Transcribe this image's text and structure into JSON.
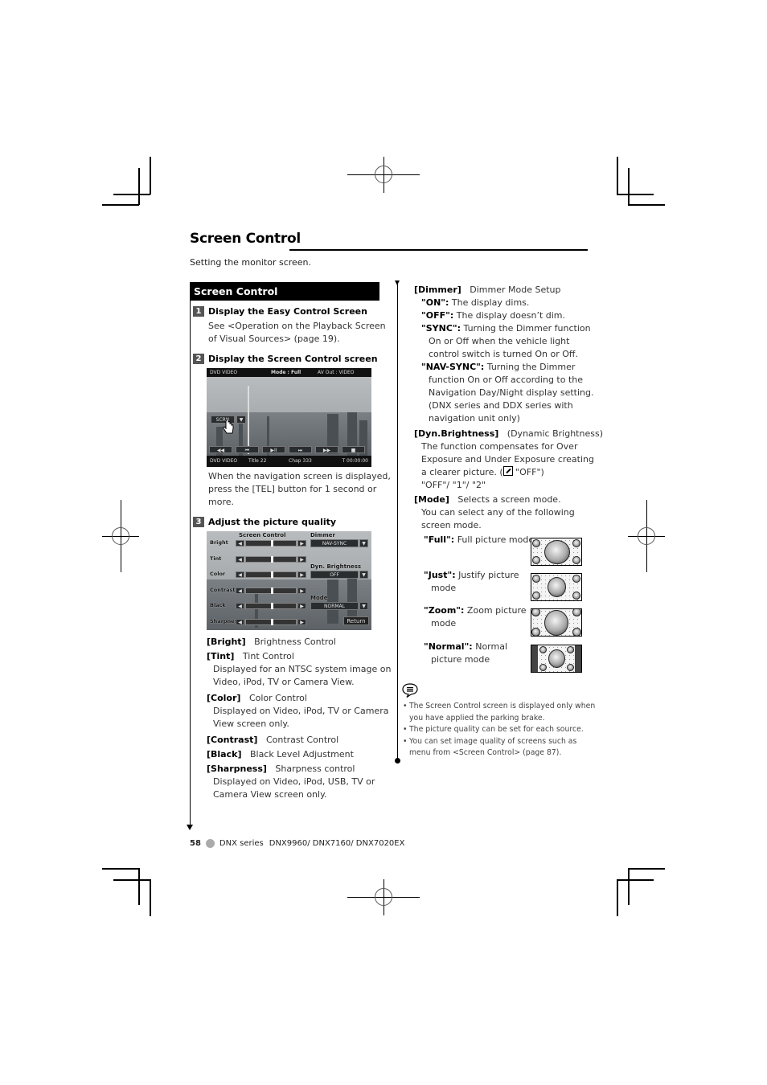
{
  "page": {
    "title": "Screen Control",
    "intro": "Setting the monitor screen.",
    "section_header": "Screen Control"
  },
  "steps": [
    {
      "num": "1",
      "title": "Display the Easy Control Screen",
      "text_lines": [
        "See <Operation on the Playback Screen",
        "of Visual Sources> (page 19)."
      ]
    },
    {
      "num": "2",
      "title": "Display the Screen Control screen",
      "text_lines": [
        "When the navigation screen is displayed,",
        "press the [TEL] button for 1 second or",
        "more."
      ]
    },
    {
      "num": "3",
      "title": "Adjust the picture quality"
    }
  ],
  "easy_control_screen": {
    "top_left": "DVD VIDEO",
    "top_mode": "Mode : Full",
    "top_av": "AV Out : VIDEO",
    "scrn_button": "SCRN",
    "scrn_arrow": "▼",
    "transport": [
      "◀◀",
      "⏮",
      "▶II",
      "⏭",
      "▶▶",
      "■"
    ],
    "bottom_left": "DVD VIDEO",
    "bottom_title": "Title 22",
    "bottom_chap": "Chap 333",
    "bottom_time": "T 00:00:00"
  },
  "screen_control_screen": {
    "heading": "Screen Control",
    "rows": [
      {
        "label": "Bright",
        "level": 0.5
      },
      {
        "label": "Tint",
        "level": 0.5
      },
      {
        "label": "Color",
        "level": 0.5
      },
      {
        "label": "Contrast",
        "level": 0.5
      },
      {
        "label": "Black",
        "level": 0.5
      },
      {
        "label": "Sharpness",
        "level": 0.5
      }
    ],
    "dimmer_label": "Dimmer",
    "dimmer_value": "NAV-SYNC",
    "dyn_label": "Dyn. Brightness",
    "dyn_value": "OFF",
    "mode_label": "Mode",
    "mode_value": "NORMAL",
    "return_label": "Return",
    "left_arrow": "◀",
    "right_arrow": "▶",
    "dropdown_arrow": "▼"
  },
  "left_items": [
    {
      "term": "[Bright]",
      "desc": "Brightness Control",
      "extra": []
    },
    {
      "term": "[Tint]",
      "desc": "Tint Control",
      "extra": [
        "Displayed for an NTSC system image on",
        "Video, iPod, TV or Camera View."
      ]
    },
    {
      "term": "[Color]",
      "desc": "Color Control",
      "extra": [
        "Displayed on Video, iPod, TV or Camera",
        "View screen only."
      ]
    },
    {
      "term": "[Contrast]",
      "desc": "Contrast Control",
      "extra": []
    },
    {
      "term": "[Black]",
      "desc": "Black Level Adjustment",
      "extra": []
    },
    {
      "term": "[Sharpness]",
      "desc": "Sharpness control",
      "extra": [
        "Displayed on Video, iPod, USB, TV or",
        "Camera View screen only."
      ]
    }
  ],
  "dimmer": {
    "term": "[Dimmer]",
    "desc": "Dimmer Mode Setup",
    "options": [
      {
        "key": "\"ON\":",
        "lines": [
          "The display dims."
        ]
      },
      {
        "key": "\"OFF\":",
        "lines": [
          "The display doesn’t dim."
        ]
      },
      {
        "key": "\"SYNC\":",
        "lines": [
          "Turning the Dimmer function",
          "On or Off when the vehicle light",
          "control switch is turned On or Off."
        ]
      },
      {
        "key": "\"NAV-SYNC\":",
        "lines": [
          "Turning the Dimmer",
          "function On or Off according to the",
          "Navigation Day/Night display setting.",
          "(DNX series and DDX series with",
          "navigation unit only)"
        ]
      }
    ]
  },
  "dyn_brightness": {
    "term": "[Dyn.Brightness]",
    "desc": "(Dynamic Brightness)",
    "lines": [
      "The function compensates for Over",
      "Exposure and Under Exposure creating",
      "a clearer picture. ("
    ],
    "default_text": " \"OFF\")",
    "values": "\"OFF\"/ \"1\"/ \"2\""
  },
  "mode": {
    "term": "[Mode]",
    "desc": "Selects a screen mode.",
    "lines": [
      "You can select any of the following",
      "screen mode."
    ],
    "options": [
      {
        "key": "\"Full\":",
        "lines": [
          "Full picture mode"
        ]
      },
      {
        "key": "\"Just\":",
        "lines": [
          "Justify picture",
          "mode"
        ]
      },
      {
        "key": "\"Zoom\":",
        "lines": [
          "Zoom picture",
          "mode"
        ]
      },
      {
        "key": "\"Normal\":",
        "lines": [
          "Normal",
          "picture mode"
        ]
      }
    ]
  },
  "notes": [
    [
      "The Screen Control screen is displayed only when",
      "you have applied the parking brake."
    ],
    [
      "The picture quality can be set for each source."
    ],
    [
      "You can set image quality of screens such as",
      "menu from <Screen Control> (page 87)."
    ]
  ],
  "footer": {
    "page_number": "58",
    "series": "DNX series",
    "models": "DNX9960/ DNX7160/ DNX7020EX"
  }
}
